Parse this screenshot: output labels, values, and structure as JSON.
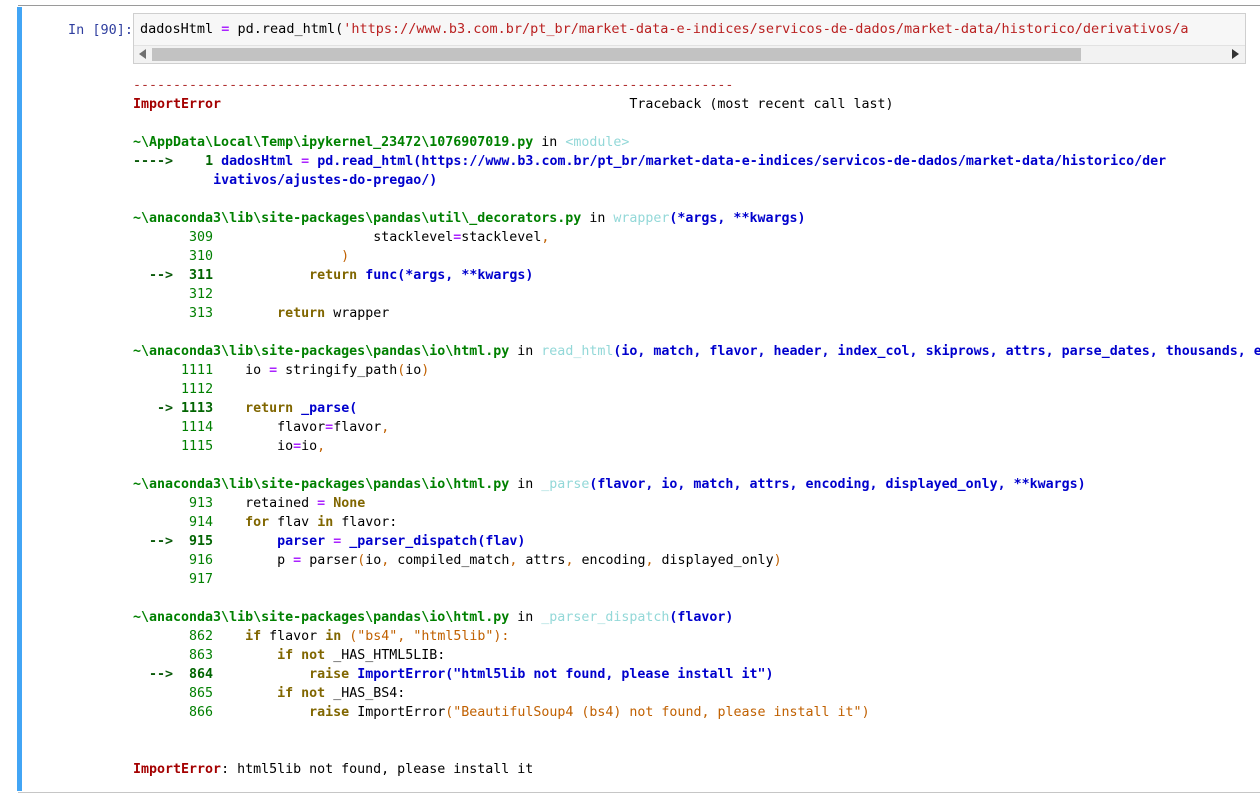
{
  "cell": {
    "prompt": "In [90]:",
    "code_segments": [
      {
        "t": "dadosHtml ",
        "c": "plain"
      },
      {
        "t": "= ",
        "c": "op"
      },
      {
        "t": "pd.read_html(",
        "c": "plain"
      },
      {
        "t": "'https://www.b3.com.br/pt_br/market-data-e-indices/servicos-de-dados/market-data/historico/derivativos/a",
        "c": "strq"
      }
    ],
    "code_plain": "dadosHtml = pd.read_html('https://www.b3.com.br/pt_br/market-data-e-indices/servicos-de-dados/market-data/historico/derivativos/a",
    "scrollbar": {
      "left_arrow": "◀",
      "right_arrow": "▶"
    }
  },
  "traceback": {
    "separator": "---------------------------------------------------------------------------",
    "exception_name": "ImportError",
    "traceback_label": "Traceback (most recent call last)",
    "final_error": {
      "name": "ImportError",
      "message": ": html5lib not found, please install it"
    },
    "frames": [
      {
        "path": "~\\AppData\\Local\\Temp\\ipykernel_23472\\1076907019.py",
        "in": " in ",
        "func": "<module>",
        "func_args": "",
        "lines": [
          {
            "marker": "---->",
            "num": "1",
            "highlight": true,
            "code": " dadosHtml = pd.read_html('https://www.b3.com.br/pt_br/market-data-e-indices/servicos-de-dados/market-data/historico/der"
          },
          {
            "marker": "",
            "num": "",
            "highlight": true,
            "code": "ivativos/ajustes-do-pregao/')"
          }
        ]
      },
      {
        "path": "~\\anaconda3\\lib\\site-packages\\pandas\\util\\_decorators.py",
        "in": " in ",
        "func": "wrapper",
        "func_args": "(*args, **kwargs)",
        "lines": [
          {
            "marker": "",
            "num": "309",
            "highlight": false,
            "code": "                    stacklevel=stacklevel,"
          },
          {
            "marker": "",
            "num": "310",
            "highlight": false,
            "code": "                )"
          },
          {
            "marker": "-->",
            "num": "311",
            "highlight": true,
            "code": "            return func(*args, **kwargs)"
          },
          {
            "marker": "",
            "num": "312",
            "highlight": false,
            "code": ""
          },
          {
            "marker": "",
            "num": "313",
            "highlight": false,
            "code": "        return wrapper"
          }
        ]
      },
      {
        "path": "~\\anaconda3\\lib\\site-packages\\pandas\\io\\html.py",
        "in": " in ",
        "func": "read_html",
        "func_args": "(io, match, flavor, header, index_col, skiprows, attrs, parse_dates, thousands, encoding, decimal, converters, na_values, keep_default_na, displayed_only)",
        "lines": [
          {
            "marker": "",
            "num": "1111",
            "highlight": false,
            "code": "    io = stringify_path(io)"
          },
          {
            "marker": "",
            "num": "1112",
            "highlight": false,
            "code": ""
          },
          {
            "marker": "->",
            "num": "1113",
            "highlight": true,
            "code": "    return _parse("
          },
          {
            "marker": "",
            "num": "1114",
            "highlight": false,
            "code": "        flavor=flavor,"
          },
          {
            "marker": "",
            "num": "1115",
            "highlight": false,
            "code": "        io=io,"
          }
        ]
      },
      {
        "path": "~\\anaconda3\\lib\\site-packages\\pandas\\io\\html.py",
        "in": " in ",
        "func": "_parse",
        "func_args": "(flavor, io, match, attrs, encoding, displayed_only, **kwargs)",
        "lines": [
          {
            "marker": "",
            "num": "913",
            "highlight": false,
            "code": "    retained = None"
          },
          {
            "marker": "",
            "num": "914",
            "highlight": false,
            "code": "    for flav in flavor:"
          },
          {
            "marker": "-->",
            "num": "915",
            "highlight": true,
            "code": "        parser = _parser_dispatch(flav)"
          },
          {
            "marker": "",
            "num": "916",
            "highlight": false,
            "code": "        p = parser(io, compiled_match, attrs, encoding, displayed_only)"
          },
          {
            "marker": "",
            "num": "917",
            "highlight": false,
            "code": ""
          }
        ]
      },
      {
        "path": "~\\anaconda3\\lib\\site-packages\\pandas\\io\\html.py",
        "in": " in ",
        "func": "_parser_dispatch",
        "func_args": "(flavor)",
        "lines": [
          {
            "marker": "",
            "num": "862",
            "highlight": false,
            "code": "    if flavor in (\"bs4\", \"html5lib\"):"
          },
          {
            "marker": "",
            "num": "863",
            "highlight": false,
            "code": "        if not _HAS_HTML5LIB:"
          },
          {
            "marker": "-->",
            "num": "864",
            "highlight": true,
            "code": "            raise ImportError(\"html5lib not found, please install it\")"
          },
          {
            "marker": "",
            "num": "865",
            "highlight": false,
            "code": "        if not _HAS_BS4:"
          },
          {
            "marker": "",
            "num": "866",
            "highlight": false,
            "code": "            raise ImportError(\"BeautifulSoup4 (bs4) not found, please install it\")"
          }
        ]
      }
    ]
  },
  "colors": {
    "cell_marker": "#42a5f5",
    "error_red": "#A40000",
    "path_green": "#008000",
    "string_blue": "#0000CD",
    "keyword_olive": "#806600",
    "url_red": "#BA2121",
    "func_teal": "#93D8D8"
  }
}
